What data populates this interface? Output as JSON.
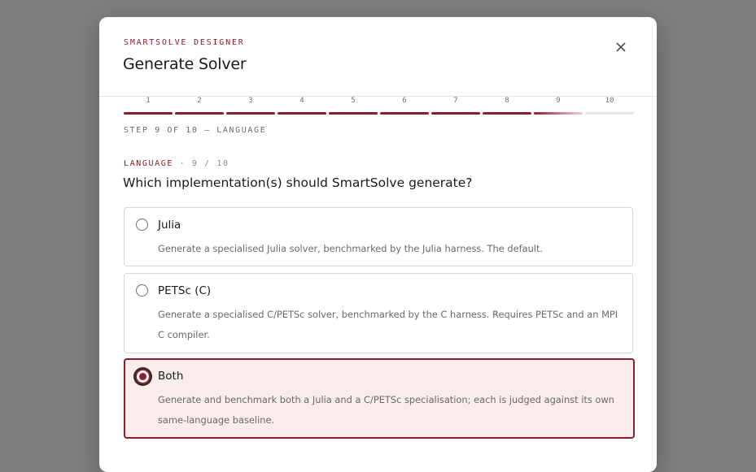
{
  "modal": {
    "eyebrow": "SMARTSOLVE DESIGNER",
    "title": "Generate Solver",
    "close_icon": "close-icon"
  },
  "stepper": {
    "steps": [
      {
        "label": "1",
        "state": "done"
      },
      {
        "label": "2",
        "state": "done"
      },
      {
        "label": "3",
        "state": "done"
      },
      {
        "label": "4",
        "state": "done"
      },
      {
        "label": "5",
        "state": "done"
      },
      {
        "label": "6",
        "state": "done"
      },
      {
        "label": "7",
        "state": "done"
      },
      {
        "label": "8",
        "state": "done"
      },
      {
        "label": "9",
        "state": "current"
      },
      {
        "label": "10",
        "state": "todo"
      }
    ],
    "status": "STEP 9 OF 10 — LANGUAGE"
  },
  "question": {
    "category": "LANGUAGE",
    "separator": "·",
    "count": "9 / 10",
    "text": "Which implementation(s) should SmartSolve generate?"
  },
  "options": [
    {
      "title": "Julia",
      "description": "Generate a specialised Julia solver, benchmarked by the Julia harness. The default.",
      "selected": false
    },
    {
      "title": "PETSc (C)",
      "description": "Generate a specialised C/PETSc solver, benchmarked by the C harness. Requires PETSc and an MPI C compiler.",
      "selected": false
    },
    {
      "title": "Both",
      "description": "Generate and benchmark both a Julia and a C/PETSc specialisation; each is judged against its own same-language baseline.",
      "selected": true
    }
  ],
  "colors": {
    "accent": "#8a1f2b",
    "selected_bg": "#f8eced",
    "backdrop": "#7d7e80"
  }
}
